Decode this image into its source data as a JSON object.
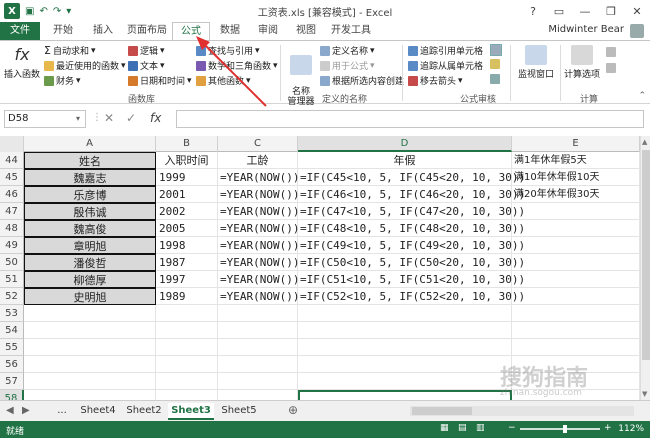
{
  "window": {
    "title": "工资表.xls [兼容模式] - Excel",
    "help": "?",
    "user": "Midwinter Bear"
  },
  "tabs": [
    {
      "label": "文件"
    },
    {
      "label": "开始"
    },
    {
      "label": "插入"
    },
    {
      "label": "页面布局"
    },
    {
      "label": "公式",
      "active": true
    },
    {
      "label": "数据"
    },
    {
      "label": "审阅"
    },
    {
      "label": "视图"
    },
    {
      "label": "开发工具"
    }
  ],
  "ribbon": {
    "insert_function": "插入函数",
    "autosum": "自动求和",
    "recent": "最近使用的函数",
    "financial": "财务",
    "logical": "逻辑",
    "text": "文本",
    "datetime": "日期和时间",
    "lookup": "查找与引用",
    "math": "数学和三角函数",
    "other": "其他函数",
    "library_group": "函数库",
    "name_manager": "名称\n管理器",
    "define_name": "定义名称",
    "use_in_formula": "用于公式",
    "create_from_sel": "根据所选内容创建",
    "names_group": "定义的名称",
    "trace_precedents": "追踪引用单元格",
    "trace_dependents": "追踪从属单元格",
    "remove_arrows": "移去箭头",
    "audit_group": "公式审核",
    "watch": "监视窗口",
    "calc_options": "计算选项",
    "calc_group": "计算"
  },
  "formula_bar": {
    "name_box": "D58",
    "fx": "fx",
    "value": ""
  },
  "columns": [
    {
      "label": "A"
    },
    {
      "label": "B"
    },
    {
      "label": "C"
    },
    {
      "label": "D",
      "selected": true
    },
    {
      "label": "E"
    }
  ],
  "rows": [
    {
      "num": "44",
      "a": "姓名",
      "b": "入职时间",
      "c": "工龄",
      "d": "年假",
      "e": "满1年休年假5天"
    },
    {
      "num": "45",
      "a": "魏嘉志",
      "b": "1999",
      "c": "=YEAR(NOW())",
      "d": "=IF(C45<10, 5, IF(C45<20, 10, 30))",
      "e": "满10年休年假10天"
    },
    {
      "num": "46",
      "a": "乐彦博",
      "b": "2001",
      "c": "=YEAR(NOW())",
      "d": "=IF(C46<10, 5, IF(C46<20, 10, 30))",
      "e": "满20年休年假30天"
    },
    {
      "num": "47",
      "a": "殷伟诚",
      "b": "2002",
      "c": "=YEAR(NOW())",
      "d": "=IF(C47<10, 5, IF(C47<20, 10, 30))",
      "e": ""
    },
    {
      "num": "48",
      "a": "魏高俊",
      "b": "2005",
      "c": "=YEAR(NOW())",
      "d": "=IF(C48<10, 5, IF(C48<20, 10, 30))",
      "e": ""
    },
    {
      "num": "49",
      "a": "章明旭",
      "b": "1998",
      "c": "=YEAR(NOW())",
      "d": "=IF(C49<10, 5, IF(C49<20, 10, 30))",
      "e": ""
    },
    {
      "num": "50",
      "a": "潘俊哲",
      "b": "1987",
      "c": "=YEAR(NOW())",
      "d": "=IF(C50<10, 5, IF(C50<20, 10, 30))",
      "e": ""
    },
    {
      "num": "51",
      "a": "柳德厚",
      "b": "1997",
      "c": "=YEAR(NOW())",
      "d": "=IF(C51<10, 5, IF(C51<20, 10, 30))",
      "e": ""
    },
    {
      "num": "52",
      "a": "史明旭",
      "b": "1989",
      "c": "=YEAR(NOW())",
      "d": "=IF(C52<10, 5, IF(C52<20, 10, 30))",
      "e": ""
    },
    {
      "num": "53",
      "a": "",
      "b": "",
      "c": "",
      "d": "",
      "e": ""
    },
    {
      "num": "54",
      "a": "",
      "b": "",
      "c": "",
      "d": "",
      "e": ""
    },
    {
      "num": "55",
      "a": "",
      "b": "",
      "c": "",
      "d": "",
      "e": ""
    },
    {
      "num": "56",
      "a": "",
      "b": "",
      "c": "",
      "d": "",
      "e": ""
    },
    {
      "num": "57",
      "a": "",
      "b": "",
      "c": "",
      "d": "",
      "e": ""
    },
    {
      "num": "58",
      "a": "",
      "b": "",
      "c": "",
      "d": "",
      "e": "",
      "selected": true
    }
  ],
  "sheets": [
    {
      "label": "..."
    },
    {
      "label": "Sheet4"
    },
    {
      "label": "Sheet2"
    },
    {
      "label": "Sheet3",
      "active": true
    },
    {
      "label": "Sheet5"
    }
  ],
  "status": {
    "ready": "就绪",
    "zoom": "112%"
  },
  "watermark": "搜狗指南",
  "watermark_url": "zhinan.sogou.com",
  "colors": {
    "accent": "#217346",
    "arrow": "#e03030"
  }
}
